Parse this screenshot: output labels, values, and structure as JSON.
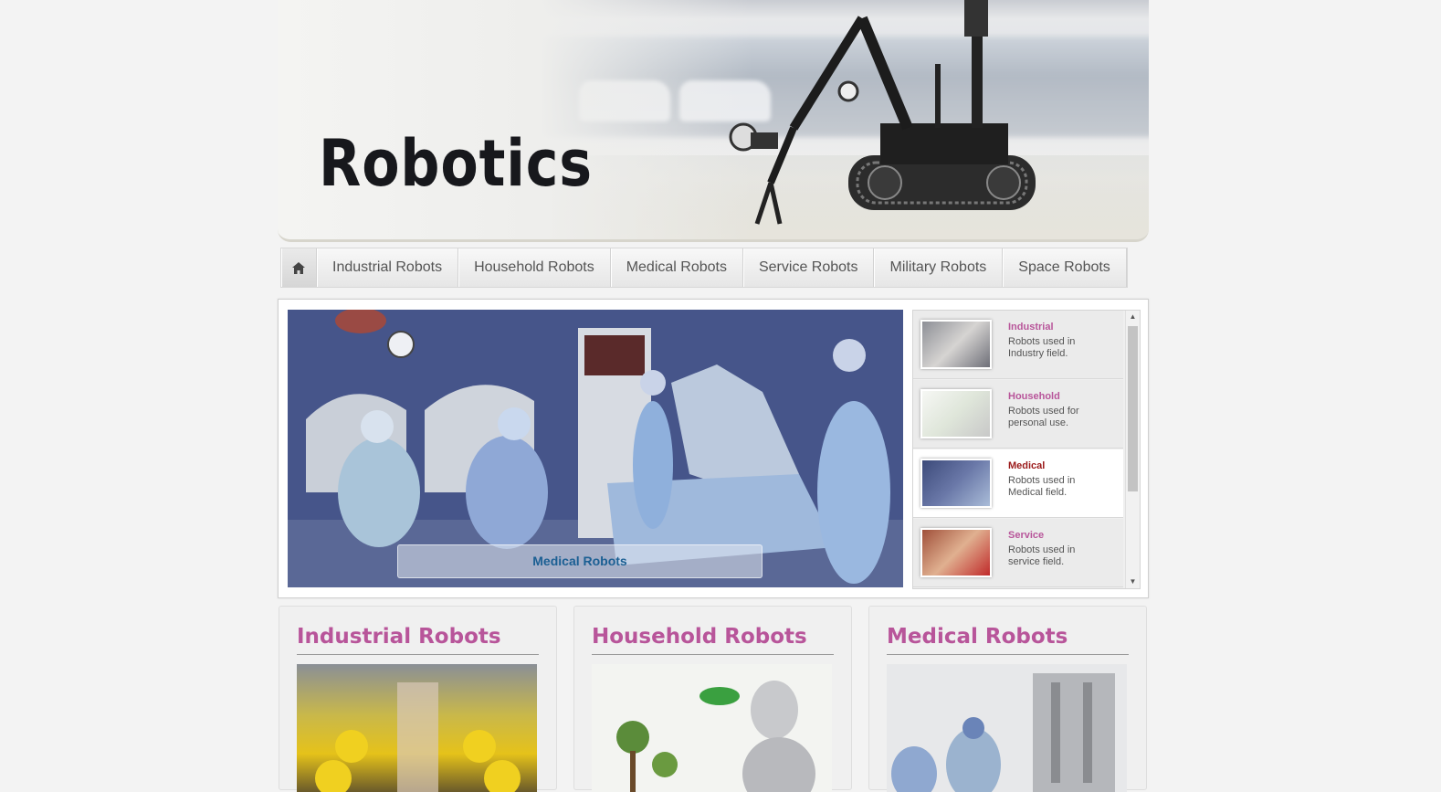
{
  "header": {
    "title": "Robotics"
  },
  "nav": {
    "home_icon": "home-icon",
    "items": [
      {
        "label": "Industrial Robots"
      },
      {
        "label": "Household Robots"
      },
      {
        "label": "Medical Robots"
      },
      {
        "label": "Service Robots"
      },
      {
        "label": "Military Robots"
      },
      {
        "label": "Space Robots"
      }
    ]
  },
  "slider": {
    "caption": "Medical Robots",
    "thumbs": [
      {
        "title": "Industrial",
        "desc": "Robots used in Industry field."
      },
      {
        "title": "Household",
        "desc": "Robots used for personal use."
      },
      {
        "title": "Medical",
        "desc": "Robots used in Medical field.",
        "active": true
      },
      {
        "title": "Service",
        "desc": "Robots used in service field."
      }
    ],
    "scroll_up_icon": "arrow-up-icon",
    "scroll_down_icon": "arrow-down-icon"
  },
  "cards": [
    {
      "title": "Industrial Robots"
    },
    {
      "title": "Household Robots"
    },
    {
      "title": "Medical Robots"
    }
  ],
  "colors": {
    "accent": "#b8559a",
    "caption": "#1b5f93",
    "active_thumb": "#9b1a1a"
  }
}
